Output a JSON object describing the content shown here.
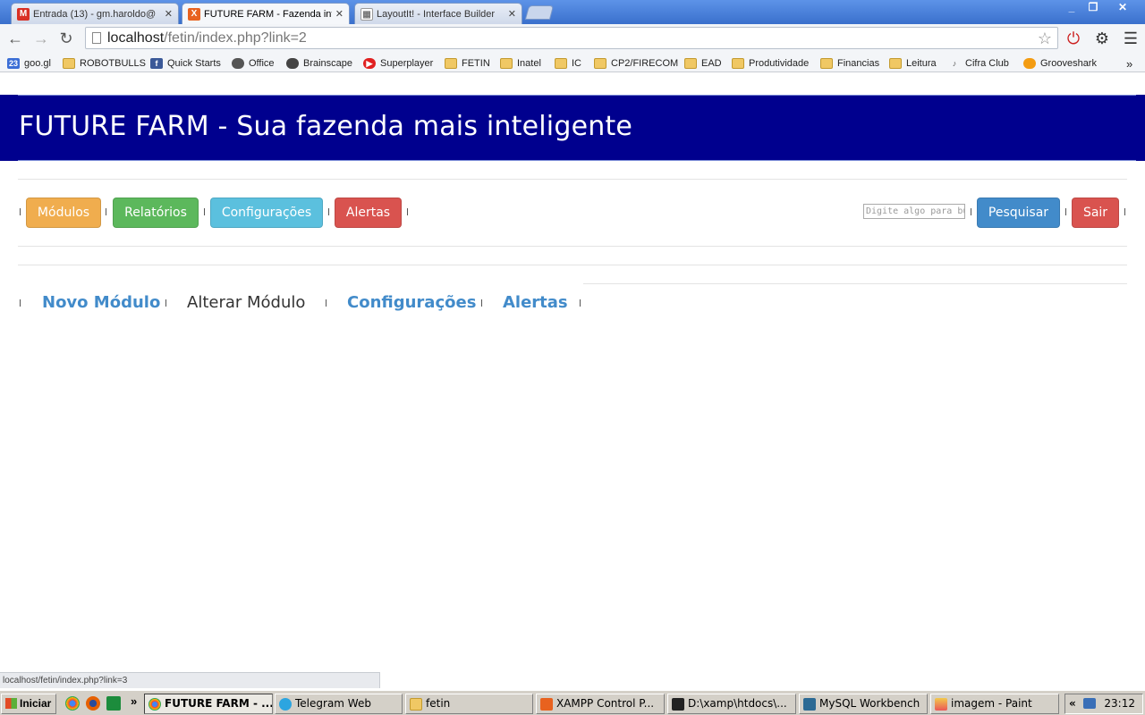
{
  "browser": {
    "tabs": [
      {
        "title": "Entrada (13) - gm.haroldo@",
        "icon": "gmail-icon"
      },
      {
        "title": "FUTURE FARM - Fazenda int",
        "icon": "xampp-icon"
      },
      {
        "title": "LayoutIt! - Interface Builder",
        "icon": "layoutit-icon"
      }
    ],
    "address": {
      "host": "localhost",
      "path": "/fetin/index.php?link=2"
    },
    "bookmarks": [
      {
        "label": "goo.gl",
        "icon": "calendar-icon"
      },
      {
        "label": "ROBOTBULLS",
        "icon": "folder-icon"
      },
      {
        "label": "Quick Starts",
        "icon": "facebook-icon"
      },
      {
        "label": "Office",
        "icon": "apple-icon"
      },
      {
        "label": "Brainscape",
        "icon": "brainscape-icon"
      },
      {
        "label": "Superplayer",
        "icon": "superplayer-icon"
      },
      {
        "label": "FETIN",
        "icon": "folder-icon"
      },
      {
        "label": "Inatel",
        "icon": "folder-icon"
      },
      {
        "label": "IC",
        "icon": "folder-icon"
      },
      {
        "label": "CP2/FIRECOM",
        "icon": "folder-icon"
      },
      {
        "label": "EAD",
        "icon": "folder-icon"
      },
      {
        "label": "Produtividade",
        "icon": "folder-icon"
      },
      {
        "label": "Financias",
        "icon": "folder-icon"
      },
      {
        "label": "Leitura",
        "icon": "folder-icon"
      },
      {
        "label": "Cifra Club",
        "icon": "guitar-icon"
      },
      {
        "label": "Grooveshark",
        "icon": "grooveshark-icon"
      }
    ],
    "bookmarks_overflow": "»",
    "status_url": "localhost/fetin/index.php?link=3"
  },
  "page": {
    "title": "FUTURE FARM - Sua fazenda mais inteligente",
    "nav": {
      "modulos": "Módulos",
      "relatorios": "Relatórios",
      "configuracoes": "Configurações",
      "alertas": "Alertas",
      "search_placeholder": "Digite algo para buscar",
      "pesquisar": "Pesquisar",
      "sair": "Sair"
    },
    "subnav": {
      "novo": "Novo Módulo",
      "alterar": "Alterar Módulo",
      "configuracoes": "Configurações",
      "alertas": "Alertas"
    },
    "colors": {
      "header": "#00008e",
      "warning": "#f0ad4e",
      "success": "#5cb85c",
      "info": "#5bc0de",
      "danger": "#d9534f",
      "primary": "#428bca"
    }
  },
  "taskbar": {
    "start": "Iniciar",
    "overflow": "»",
    "items": [
      {
        "label": "FUTURE FARM - ...",
        "icon": "chrome-icon"
      },
      {
        "label": "Telegram Web",
        "icon": "telegram-icon"
      },
      {
        "label": "fetin",
        "icon": "folder-icon"
      },
      {
        "label": "XAMPP Control P...",
        "icon": "xampp-icon"
      },
      {
        "label": "D:\\xamp\\htdocs\\...",
        "icon": "terminal-icon"
      },
      {
        "label": "MySQL Workbench",
        "icon": "mysql-icon"
      },
      {
        "label": "imagem - Paint",
        "icon": "paint-icon"
      }
    ],
    "tray_arrows": "«",
    "clock": "23:12"
  }
}
